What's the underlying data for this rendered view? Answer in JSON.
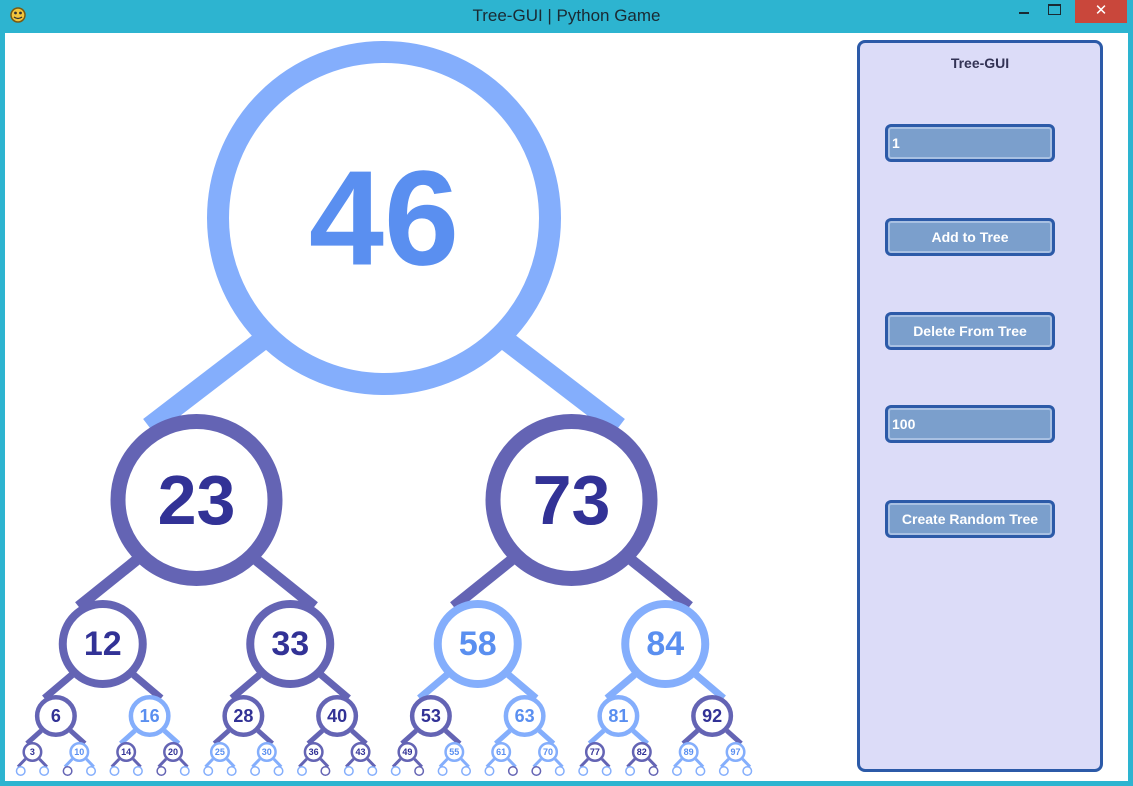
{
  "window": {
    "title": "Tree-GUI | Python Game",
    "close_symbol": "✕",
    "icons": [
      "python-app-icon",
      "minimize-icon",
      "maximize-icon",
      "close-icon"
    ]
  },
  "panel": {
    "title": "Tree-GUI",
    "value_input": "1",
    "add_button": "Add to Tree",
    "delete_button": "Delete From Tree",
    "count_input": "100",
    "random_button": "Create Random Tree"
  },
  "colors": {
    "titlebar": "#2db4d0",
    "close_button": "#c9473b",
    "light_node": "#84aefc",
    "light_text": "#5a8ff0",
    "dark_node": "#6464b4",
    "dark_text": "#323296",
    "panel_bg": "#dcdcf8",
    "panel_border": "#2c5aa8",
    "control_fill": "#7b9fcc"
  },
  "tree": {
    "v": "46",
    "c": "light",
    "l": {
      "v": "23",
      "c": "dark",
      "l": {
        "v": "12",
        "c": "dark",
        "l": {
          "v": "6",
          "c": "dark",
          "l": {
            "v": "3",
            "c": "dark",
            "l": {
              "v": "",
              "c": "light"
            },
            "r": {
              "v": "",
              "c": "light"
            }
          },
          "r": {
            "v": "10",
            "c": "light",
            "l": {
              "v": "",
              "c": "dark"
            },
            "r": {
              "v": "",
              "c": "light"
            }
          }
        },
        "r": {
          "v": "16",
          "c": "light",
          "l": {
            "v": "14",
            "c": "dark",
            "l": {
              "v": "",
              "c": "light"
            },
            "r": {
              "v": "",
              "c": "light"
            }
          },
          "r": {
            "v": "20",
            "c": "dark",
            "l": {
              "v": "",
              "c": "dark"
            },
            "r": {
              "v": "",
              "c": "light"
            }
          }
        }
      },
      "r": {
        "v": "33",
        "c": "dark",
        "l": {
          "v": "28",
          "c": "dark",
          "l": {
            "v": "25",
            "c": "light",
            "l": {
              "v": "",
              "c": "light"
            },
            "r": {
              "v": "",
              "c": "light"
            }
          },
          "r": {
            "v": "30",
            "c": "light",
            "l": {
              "v": "",
              "c": "light"
            },
            "r": {
              "v": "",
              "c": "light"
            }
          }
        },
        "r": {
          "v": "40",
          "c": "dark",
          "l": {
            "v": "36",
            "c": "dark",
            "l": {
              "v": "",
              "c": "light"
            },
            "r": {
              "v": "",
              "c": "dark"
            }
          },
          "r": {
            "v": "43",
            "c": "dark",
            "l": {
              "v": "",
              "c": "light"
            },
            "r": {
              "v": "",
              "c": "light"
            }
          }
        }
      }
    },
    "r": {
      "v": "73",
      "c": "dark",
      "l": {
        "v": "58",
        "c": "light",
        "l": {
          "v": "53",
          "c": "dark",
          "l": {
            "v": "49",
            "c": "dark",
            "l": {
              "v": "",
              "c": "light"
            },
            "r": {
              "v": "",
              "c": "dark"
            }
          },
          "r": {
            "v": "55",
            "c": "light",
            "l": {
              "v": "",
              "c": "light"
            },
            "r": {
              "v": "",
              "c": "light"
            }
          }
        },
        "r": {
          "v": "63",
          "c": "light",
          "l": {
            "v": "61",
            "c": "light",
            "l": {
              "v": "",
              "c": "light"
            },
            "r": {
              "v": "",
              "c": "dark"
            }
          },
          "r": {
            "v": "70",
            "c": "light",
            "l": {
              "v": "",
              "c": "dark"
            },
            "r": {
              "v": "",
              "c": "light"
            }
          }
        }
      },
      "r": {
        "v": "84",
        "c": "light",
        "l": {
          "v": "81",
          "c": "light",
          "l": {
            "v": "77",
            "c": "dark",
            "l": {
              "v": "",
              "c": "light"
            },
            "r": {
              "v": "",
              "c": "light"
            }
          },
          "r": {
            "v": "82",
            "c": "dark",
            "l": {
              "v": "",
              "c": "light"
            },
            "r": {
              "v": "",
              "c": "dark"
            }
          }
        },
        "r": {
          "v": "92",
          "c": "dark",
          "l": {
            "v": "89",
            "c": "light",
            "l": {
              "v": "",
              "c": "light"
            },
            "r": {
              "v": "",
              "c": "light"
            }
          },
          "r": {
            "v": "97",
            "c": "light",
            "l": {
              "v": "",
              "c": "light"
            },
            "r": {
              "v": "",
              "c": "light"
            }
          }
        }
      }
    }
  }
}
